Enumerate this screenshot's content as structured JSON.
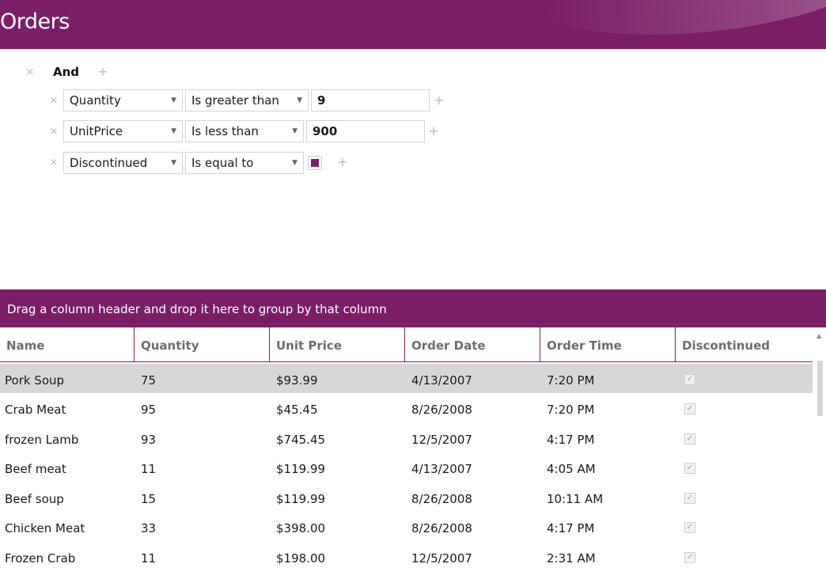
{
  "header": {
    "title": "Orders"
  },
  "filter": {
    "logic": "And",
    "conditions": [
      {
        "field": "Quantity",
        "operator": "Is greater than",
        "value": "9"
      },
      {
        "field": "UnitPrice",
        "operator": "Is less than",
        "value": "900"
      },
      {
        "field": "Discontinued",
        "operator": "Is equal to",
        "value_checked": true
      }
    ]
  },
  "grid": {
    "group_panel_text": "Drag a column header and drop it here to group by that column",
    "columns": [
      "Name",
      "Quantity",
      "Unit Price",
      "Order Date",
      "Order Time",
      "Discontinued"
    ],
    "rows": [
      {
        "name": "Pork Soup",
        "quantity": "75",
        "unit_price": "$93.99",
        "order_date": "4/13/2007",
        "order_time": "7:20 PM",
        "discontinued": true
      },
      {
        "name": "Crab Meat",
        "quantity": "95",
        "unit_price": "$45.45",
        "order_date": "8/26/2008",
        "order_time": "7:20 PM",
        "discontinued": true
      },
      {
        "name": "frozen Lamb",
        "quantity": "93",
        "unit_price": "$745.45",
        "order_date": "12/5/2007",
        "order_time": "4:17 PM",
        "discontinued": true
      },
      {
        "name": "Beef meat",
        "quantity": "11",
        "unit_price": "$119.99",
        "order_date": "4/13/2007",
        "order_time": "4:05 AM",
        "discontinued": true
      },
      {
        "name": "Beef soup",
        "quantity": "15",
        "unit_price": "$119.99",
        "order_date": "8/26/2008",
        "order_time": "10:11 AM",
        "discontinued": true
      },
      {
        "name": "Chicken Meat",
        "quantity": "33",
        "unit_price": "$398.00",
        "order_date": "8/26/2008",
        "order_time": "4:17 PM",
        "discontinued": true
      },
      {
        "name": "Frozen Crab",
        "quantity": "11",
        "unit_price": "$198.00",
        "order_date": "12/5/2007",
        "order_time": "2:31 AM",
        "discontinued": true
      }
    ],
    "selected_row": 0
  },
  "colors": {
    "accent": "#7a1f66",
    "selected_row": "#d8d6d8"
  },
  "icons": {
    "remove": "close-icon",
    "add": "plus-icon",
    "dropdown": "chevron-down-icon",
    "check": "checkmark-icon"
  }
}
